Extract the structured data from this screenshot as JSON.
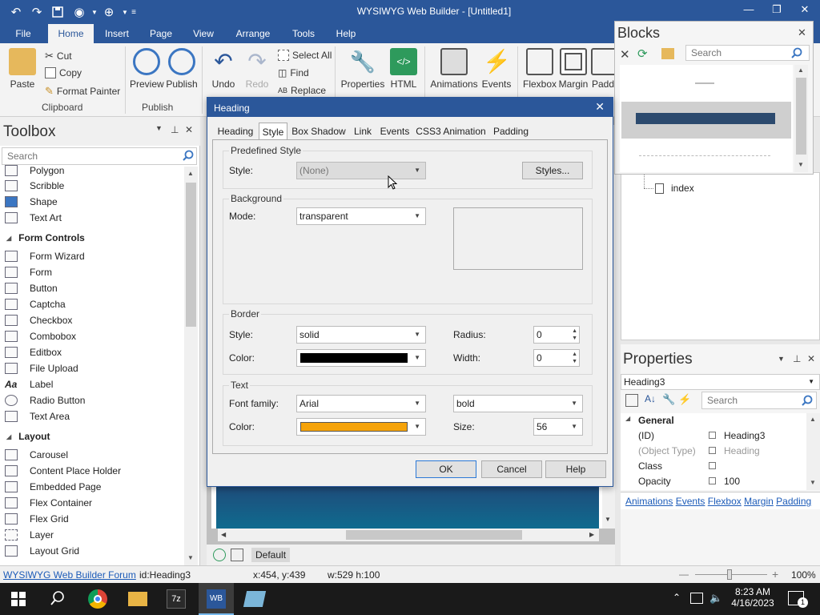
{
  "app": {
    "title": "WYSIWYG Web Builder - [Untitled1]"
  },
  "menu": {
    "tabs": [
      "File",
      "Home",
      "Insert",
      "Page",
      "View",
      "Arrange",
      "Tools",
      "Help"
    ],
    "active": "Home"
  },
  "ribbon": {
    "paste": "Paste",
    "cut": "Cut",
    "copy": "Copy",
    "format_painter": "Format Painter",
    "clipboard_label": "Clipboard",
    "preview": "Preview",
    "publish": "Publish",
    "publish_group_label": "Publish",
    "undo": "Undo",
    "redo": "Redo",
    "select_all": "Select All",
    "find": "Find",
    "replace": "Replace",
    "properties": "Properties",
    "html": "HTML",
    "animations": "Animations",
    "events": "Events",
    "flexbox": "Flexbox",
    "margin": "Margin",
    "padding": "Padd"
  },
  "toolbox": {
    "title": "Toolbox",
    "search_placeholder": "Search",
    "items_top": [
      "Polygon",
      "Scribble",
      "Shape",
      "Text Art"
    ],
    "cat_form": "Form Controls",
    "items_form": [
      "Form Wizard",
      "Form",
      "Button",
      "Captcha",
      "Checkbox",
      "Combobox",
      "Editbox",
      "File Upload",
      "Label",
      "Radio Button",
      "Text Area"
    ],
    "cat_layout": "Layout",
    "items_layout": [
      "Carousel",
      "Content Place Holder",
      "Embedded Page",
      "Flex Container",
      "Flex Grid",
      "Layer",
      "Layout Grid"
    ]
  },
  "blocks": {
    "title": "Blocks",
    "search_placeholder": "Search"
  },
  "sitetree": {
    "page": "index"
  },
  "properties": {
    "title": "Properties",
    "selected": "Heading3",
    "search_placeholder": "Search",
    "category": "General",
    "rows": [
      {
        "name": "(ID)",
        "value": "Heading3"
      },
      {
        "name": "(Object Type)",
        "value": "Heading"
      },
      {
        "name": "Class",
        "value": ""
      },
      {
        "name": "Opacity",
        "value": "100"
      }
    ],
    "links": [
      "Animations",
      "Events",
      "Flexbox",
      "Margin",
      "Padding"
    ]
  },
  "dialog": {
    "title": "Heading",
    "tabs": [
      "Heading",
      "Style",
      "Box Shadow",
      "Link",
      "Events",
      "CSS3 Animation",
      "Padding"
    ],
    "active_tab": "Style",
    "predefined": {
      "legend": "Predefined Style",
      "style_label": "Style:",
      "style_value": "(None)",
      "styles_button": "Styles..."
    },
    "background": {
      "legend": "Background",
      "mode_label": "Mode:",
      "mode_value": "transparent"
    },
    "border": {
      "legend": "Border",
      "style_label": "Style:",
      "style_value": "solid",
      "color_label": "Color:",
      "color": "#000000",
      "radius_label": "Radius:",
      "radius_value": "0",
      "width_label": "Width:",
      "width_value": "0"
    },
    "text": {
      "legend": "Text",
      "font_label": "Font family:",
      "font_value": "Arial",
      "weight_value": "bold",
      "color_label": "Color:",
      "color": "#f5a30a",
      "size_label": "Size:",
      "size_value": "56"
    },
    "buttons": {
      "ok": "OK",
      "cancel": "Cancel",
      "help": "Help"
    }
  },
  "canvas": {
    "mode": "Default"
  },
  "status": {
    "forum": "WYSIWYG Web Builder Forum",
    "id": "id:Heading3",
    "pos": "x:454, y:439",
    "size": "w:529 h:100",
    "zoom": "100%"
  },
  "taskbar": {
    "time": "8:23 AM",
    "date": "4/16/2023",
    "notif": "1"
  }
}
